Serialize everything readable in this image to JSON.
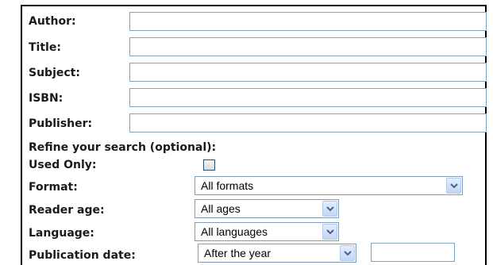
{
  "fields": {
    "author_label": "Author:",
    "title_label": "Title:",
    "subject_label": "Subject:",
    "isbn_label": "ISBN:",
    "publisher_label": "Publisher:"
  },
  "refine": {
    "heading": "Refine your search (optional):",
    "used_only_label": "Used Only:",
    "format_label": "Format:",
    "format_value": "All formats",
    "reader_age_label": "Reader age:",
    "reader_age_value": "All ages",
    "language_label": "Language:",
    "language_value": "All languages",
    "pubdate_label": "Publication date:",
    "pubdate_value": "After the year"
  },
  "icons": {
    "dropdown": "chevron-down-icon",
    "checkbox": "checkbox-icon"
  }
}
